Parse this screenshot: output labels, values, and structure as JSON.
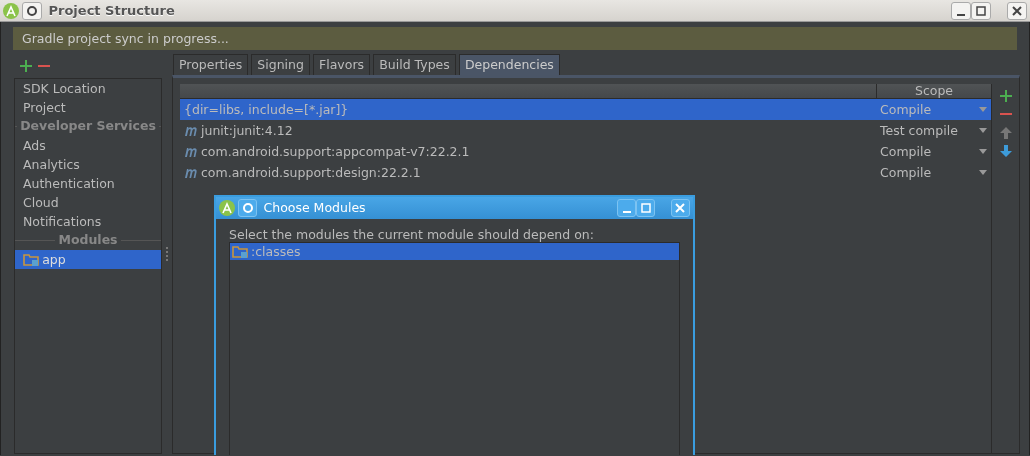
{
  "window": {
    "title": "Project Structure"
  },
  "banner": "Gradle project sync in progress...",
  "sidebar": {
    "items": [
      {
        "kind": "item",
        "label": "SDK Location",
        "selected": false
      },
      {
        "kind": "item",
        "label": "Project",
        "selected": false
      },
      {
        "kind": "header",
        "label": "Developer Services"
      },
      {
        "kind": "item",
        "label": "Ads",
        "selected": false
      },
      {
        "kind": "item",
        "label": "Analytics",
        "selected": false
      },
      {
        "kind": "item",
        "label": "Authentication",
        "selected": false
      },
      {
        "kind": "item",
        "label": "Cloud",
        "selected": false
      },
      {
        "kind": "item",
        "label": "Notifications",
        "selected": false
      },
      {
        "kind": "header",
        "label": "Modules"
      },
      {
        "kind": "module",
        "label": "app",
        "selected": true
      }
    ]
  },
  "tabs": [
    {
      "label": "Properties",
      "selected": false
    },
    {
      "label": "Signing",
      "selected": false
    },
    {
      "label": "Flavors",
      "selected": false
    },
    {
      "label": "Build Types",
      "selected": false
    },
    {
      "label": "Dependencies",
      "selected": true
    }
  ],
  "table": {
    "columns": [
      "Scope"
    ],
    "rows": [
      {
        "kind": "file",
        "name": "{dir=libs, include=[*.jar]}",
        "scope": "Compile",
        "selected": true
      },
      {
        "kind": "maven",
        "name": "junit:junit:4.12",
        "scope": "Test compile",
        "selected": false
      },
      {
        "kind": "maven",
        "name": "com.android.support:appcompat-v7:22.2.1",
        "scope": "Compile",
        "selected": false
      },
      {
        "kind": "maven",
        "name": "com.android.support:design:22.2.1",
        "scope": "Compile",
        "selected": false
      }
    ]
  },
  "dialog": {
    "title": "Choose Modules",
    "prompt": "Select the modules the current module should depend on:",
    "modules": [
      {
        "label": ":classes",
        "selected": true
      }
    ]
  }
}
